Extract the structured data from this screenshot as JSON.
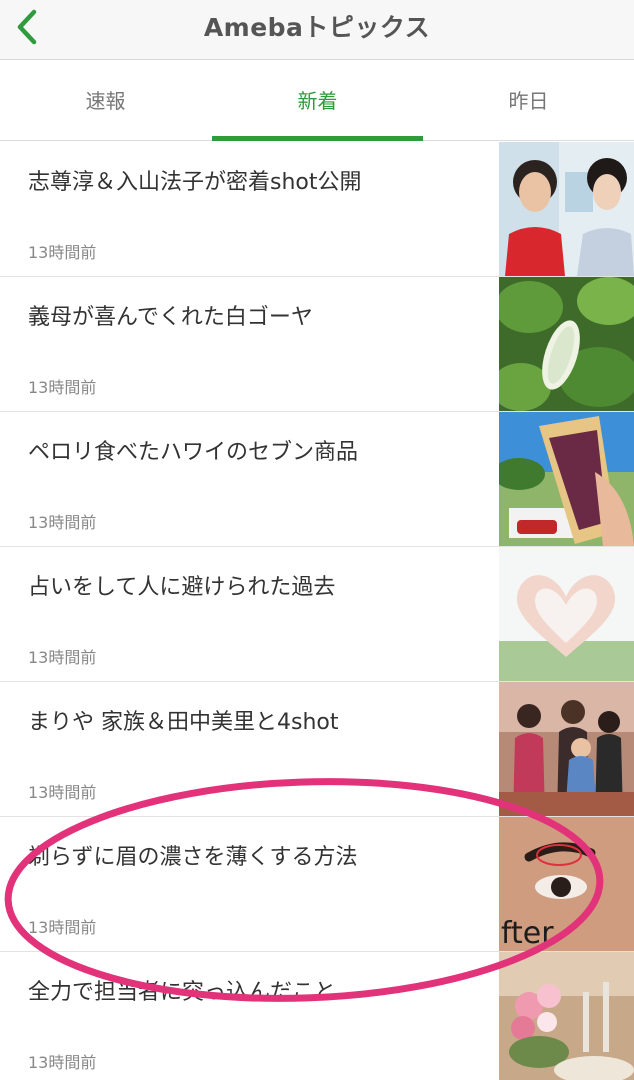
{
  "navbar": {
    "title": "Amebaトピックス",
    "back_icon": "chevron-left-icon",
    "accent_color": "#2e9b3d"
  },
  "tabs": [
    {
      "label": "速報",
      "active": false
    },
    {
      "label": "新着",
      "active": true
    },
    {
      "label": "昨日",
      "active": false
    }
  ],
  "items": [
    {
      "title": "志尊淳＆入山法子が密着shot公開",
      "time": "13時間前",
      "thumb": "photo-two-people"
    },
    {
      "title": "義母が喜んでくれた白ゴーヤ",
      "time": "13時間前",
      "thumb": "photo-white-bitter-melon"
    },
    {
      "title": "ペロリ食べたハワイのセブン商品",
      "time": "13時間前",
      "thumb": "photo-sandwich"
    },
    {
      "title": "占いをして人に避けられた過去",
      "time": "13時間前",
      "thumb": "photo-heart-hands"
    },
    {
      "title": "まりや 家族＆田中美里と4shot",
      "time": "13時間前",
      "thumb": "photo-group"
    },
    {
      "title": "剃らずに眉の濃さを薄くする方法",
      "time": "13時間前",
      "thumb": "photo-eyebrow",
      "thumb_text": "fter"
    },
    {
      "title": "全力で担当者に突っ込んだこと",
      "time": "13時間前",
      "thumb": "photo-flowers"
    }
  ],
  "annotation": {
    "shape": "ellipse",
    "color": "#e2337a"
  }
}
